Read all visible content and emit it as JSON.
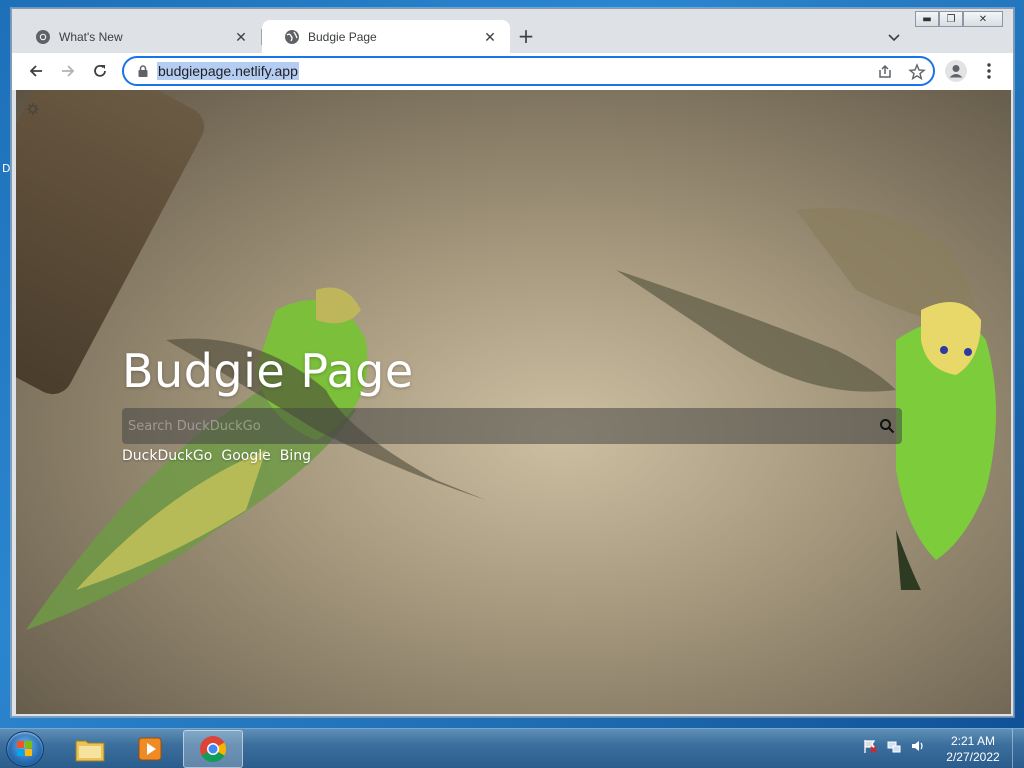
{
  "desktop": {
    "edge_letter": "D"
  },
  "browser": {
    "tabs": [
      {
        "title": "What's New",
        "active": false
      },
      {
        "title": "Budgie Page",
        "active": true
      }
    ],
    "address_url": "budgiepage.netlify.app",
    "accent_color": "#1a73e8"
  },
  "page": {
    "title": "Budgie Page",
    "search_placeholder": "Search DuckDuckGo",
    "search_engines": [
      "DuckDuckGo",
      "Google",
      "Bing"
    ]
  },
  "taskbar": {
    "pinned": [
      "file-explorer",
      "media-player",
      "chrome"
    ],
    "clock_time": "2:21 AM",
    "clock_date": "2/27/2022"
  }
}
